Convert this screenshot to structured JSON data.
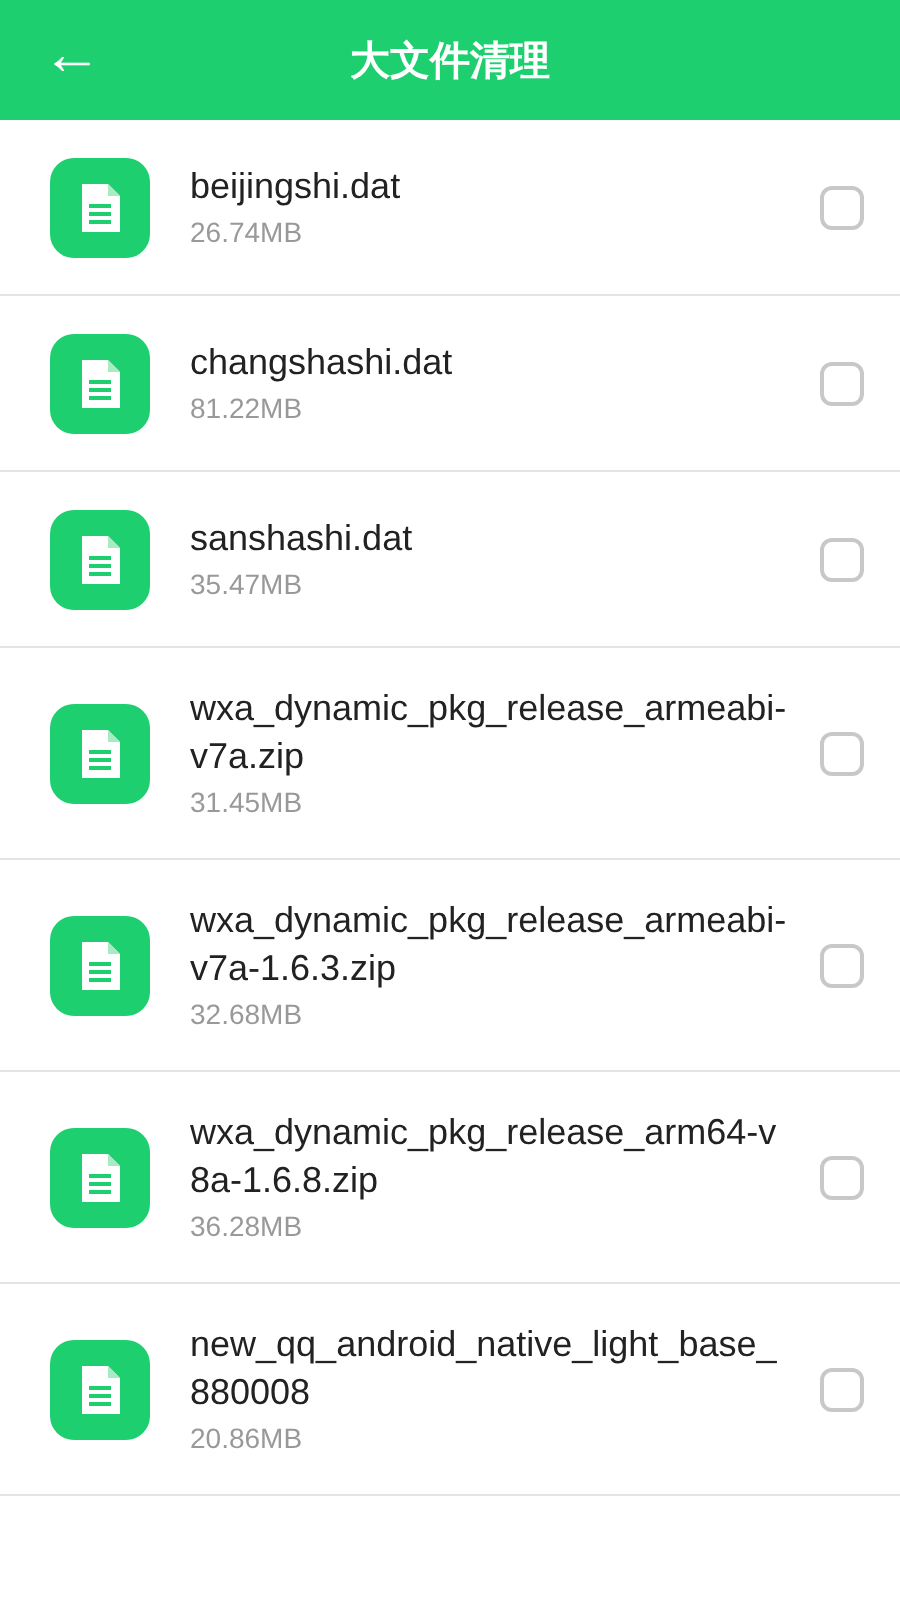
{
  "header": {
    "back_icon": "←",
    "title": "大文件清理"
  },
  "files": [
    {
      "name": "beijingshi.dat",
      "size": "26.74MB",
      "checked": false
    },
    {
      "name": "changshashi.dat",
      "size": "81.22MB",
      "checked": false
    },
    {
      "name": "sanshashi.dat",
      "size": "35.47MB",
      "checked": false
    },
    {
      "name": "wxa_dynamic_pkg_release_armeabi-v7a.zip",
      "size": "31.45MB",
      "checked": false
    },
    {
      "name": "wxa_dynamic_pkg_release_armeabi-v7a-1.6.3.zip",
      "size": "32.68MB",
      "checked": false
    },
    {
      "name": "wxa_dynamic_pkg_release_arm64-v8a-1.6.8.zip",
      "size": "36.28MB",
      "checked": false
    },
    {
      "name": "new_qq_android_native_light_base_880008",
      "size": "20.86MB",
      "checked": false
    }
  ]
}
